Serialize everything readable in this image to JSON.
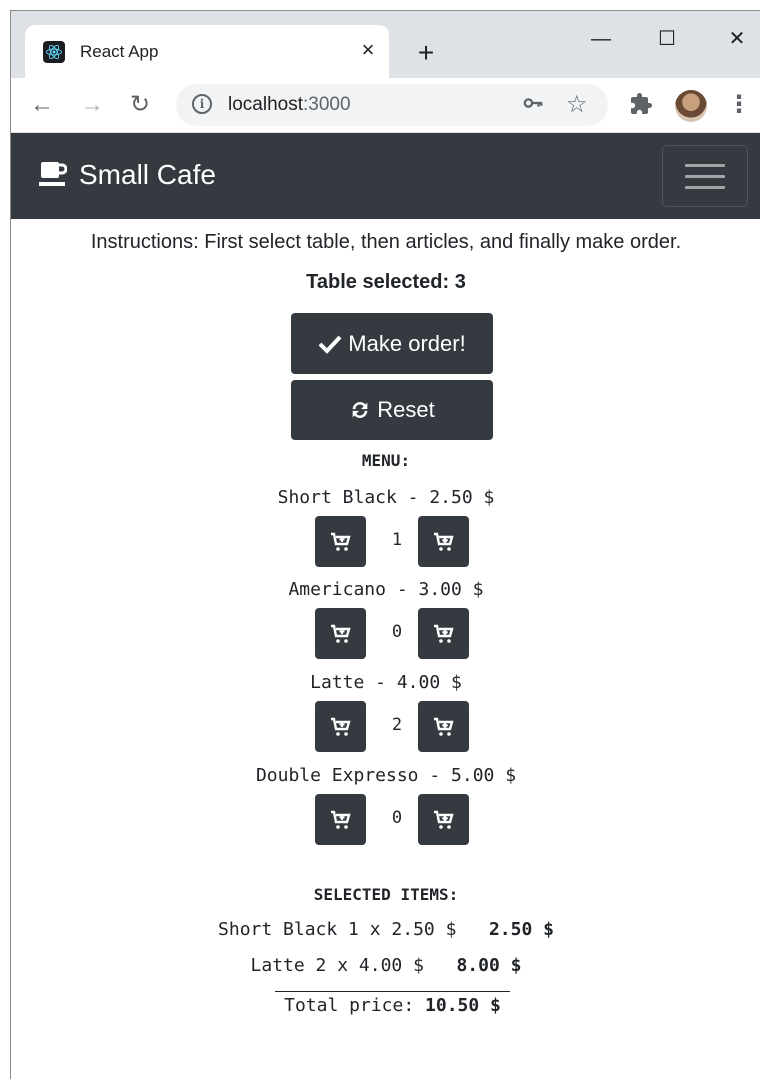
{
  "browser": {
    "tab_title": "React App",
    "tab_close": "×",
    "new_tab": "+",
    "url_host": "localhost",
    "url_port": ":3000",
    "window_minimize": "—",
    "window_maximize": "☐",
    "window_close": "✕"
  },
  "navbar": {
    "brand": "Small Cafe",
    "brand_icon": "coffee-cup-icon",
    "toggler_icon": "hamburger-menu-icon"
  },
  "instructions": "Instructions: First select table, then articles, and finally make order.",
  "table_selected": "Table selected: 3",
  "buttons": {
    "make_order": "Make order!",
    "make_order_icon": "check-icon",
    "reset": "Reset",
    "reset_icon": "sync-icon"
  },
  "menu": {
    "heading": "MENU:",
    "items": [
      {
        "name": "Short Black - 2.50 $",
        "quantity": "1"
      },
      {
        "name": "Americano - 3.00 $",
        "quantity": "0"
      },
      {
        "name": "Latte - 4.00 $",
        "quantity": "2"
      },
      {
        "name": "Double Expresso - 5.00 $",
        "quantity": "0"
      }
    ],
    "add_icon": "cart-plus-icon",
    "remove_icon": "cart-arrow-down-icon"
  },
  "selected": {
    "heading": "SELECTED ITEMS:",
    "items": [
      {
        "label": "Short Black 1 x 2.50 $",
        "subtotal": "2.50 $"
      },
      {
        "label": "Latte 2 x 4.00 $",
        "subtotal": "8.00 $"
      }
    ],
    "total_label": "Total price:",
    "total_value": "10.50 $"
  },
  "colors": {
    "navbar_bg": "#343a40",
    "button_bg": "#343a40",
    "text": "#212529"
  }
}
